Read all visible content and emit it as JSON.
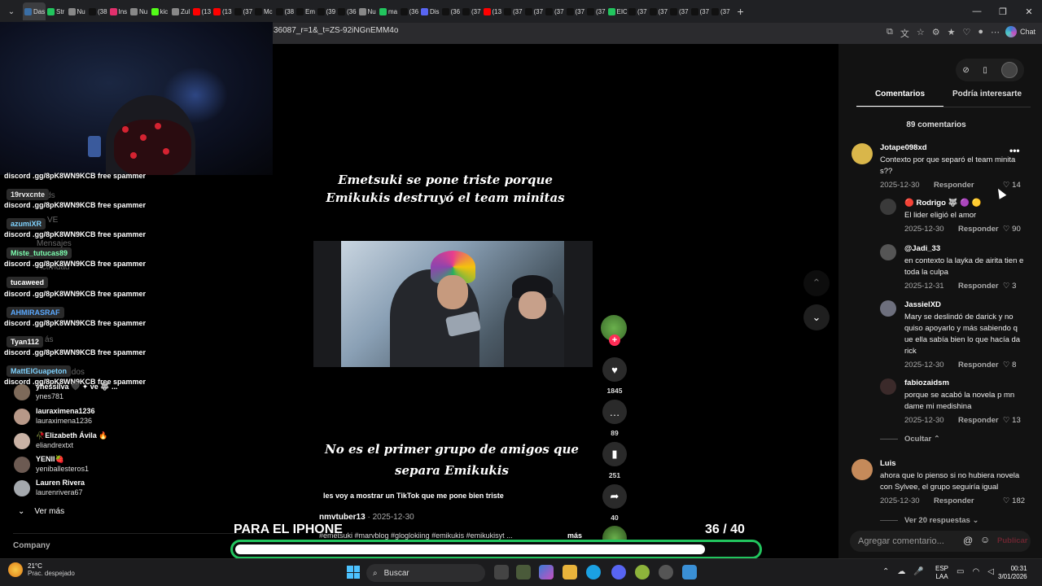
{
  "browser": {
    "tabs": [
      {
        "label": "Das",
        "color": "#3a6ea5",
        "active": true
      },
      {
        "label": "Str",
        "color": "#22c55e"
      },
      {
        "label": "Nu",
        "color": "#888888"
      },
      {
        "label": "(38",
        "color": "#111111"
      },
      {
        "label": "Ins",
        "color": "#e1306c"
      },
      {
        "label": "Nu",
        "color": "#888888"
      },
      {
        "label": "kic",
        "color": "#53fc18"
      },
      {
        "label": "Zul",
        "color": "#888888"
      },
      {
        "label": "(13",
        "color": "#ff0000"
      },
      {
        "label": "(13",
        "color": "#ff0000"
      },
      {
        "label": "(37",
        "color": "#111111"
      },
      {
        "label": "Mc",
        "color": "#111111"
      },
      {
        "label": "(38",
        "color": "#111111"
      },
      {
        "label": "Em",
        "color": "#111111"
      },
      {
        "label": "(39",
        "color": "#111111"
      },
      {
        "label": "(36",
        "color": "#111111"
      },
      {
        "label": "Nu",
        "color": "#888888"
      },
      {
        "label": "ma",
        "color": "#22c55e"
      },
      {
        "label": "(36",
        "color": "#111111"
      },
      {
        "label": "Dis",
        "color": "#5865f2"
      },
      {
        "label": "(36",
        "color": "#111111"
      },
      {
        "label": "(37",
        "color": "#111111"
      },
      {
        "label": "(13",
        "color": "#ff0000"
      },
      {
        "label": "(37",
        "color": "#111111"
      },
      {
        "label": "(37",
        "color": "#111111"
      },
      {
        "label": "(37",
        "color": "#111111"
      },
      {
        "label": "(37",
        "color": "#111111"
      },
      {
        "label": "(37",
        "color": "#111111"
      },
      {
        "label": "EIC",
        "color": "#22c55e"
      },
      {
        "label": "(37",
        "color": "#111111"
      },
      {
        "label": "(37",
        "color": "#111111"
      },
      {
        "label": "(37",
        "color": "#111111"
      },
      {
        "label": "(37",
        "color": "#111111"
      },
      {
        "label": "(37",
        "color": "#111111"
      }
    ],
    "new_tab": "+",
    "url": "36087_r=1&_t=ZS-92iNGnEMM4o",
    "chat_label": "Chat"
  },
  "stream_chat": {
    "spam_text": "discord .gg/8pK8WN9KCB free spammer",
    "users": [
      "19rvxcnte",
      "azumiXR",
      "Miste_tutucas89",
      "tucaweed",
      "AHMIRASRAF",
      "Tyan112",
      "MattElGuapeton"
    ],
    "user_colors": [
      "#e8e8e8",
      "#7fd3ff",
      "#7dffb0",
      "#ffffff",
      "#5aa9ff",
      "#ffffff",
      "#7fd3ff"
    ],
    "ghost_labels": [
      "ends",
      "VE",
      "Mensajes",
      "Actividad",
      "ás",
      "uidos"
    ]
  },
  "following": {
    "items": [
      {
        "name": "yhessilva 🖤 ✦ ve 🐺 ...",
        "handle": "ynes781"
      },
      {
        "name": "lauraximena1236",
        "handle": "lauraximena1236"
      },
      {
        "name": "🥀Elizabeth Ávila 🔥",
        "handle": "eliandrextxt"
      },
      {
        "name": "YENII🍓",
        "handle": "yeniballesteros1"
      },
      {
        "name": "Lauren Rivera",
        "handle": "laurenrivera67"
      }
    ],
    "see_more": "Ver más",
    "company": "Company"
  },
  "video": {
    "caption_top": "Emetsuki se pone triste porque Emikukis destruyó  el team minitas",
    "caption_bottom": "No es el primer grupo de amigos que separa Emikukis",
    "caption_small": "les voy a mostrar un TikTok que me pone bien triste",
    "author": "nmvtuber13",
    "date": " · 2025-12-30",
    "hashtags": "#emetsuki #marvblog #gloglokiing #emikukis #emikukisyt ...",
    "more": "más",
    "likes": "1845",
    "comments": "89",
    "saves": "251",
    "shares": "40"
  },
  "overlay": {
    "label": "PARA EL IPHONE",
    "counter": "36  / 40",
    "progress": 0.9,
    "accent": "#22c55e"
  },
  "comments_panel": {
    "tabs": [
      "Comentarios",
      "Podría interesarte"
    ],
    "count_label": "89 comentarios",
    "reply_label": "Responder",
    "hide_label": "Ocultar",
    "see_replies": "Ver 20 respuestas",
    "placeholder": "Agregar comentario...",
    "publish": "Publicar",
    "comments": [
      {
        "user": "Jotape098xd",
        "text": "Contexto por que separó el team minita s??",
        "date": "2025-12-30",
        "likes": "14"
      },
      {
        "user": "🔴 Rodrigo 🐺 🟣 🟡",
        "text": "El lider eligió el amor",
        "date": "2025-12-30",
        "likes": "90"
      },
      {
        "user": "@Jadi_33",
        "text": "en contexto la layka de airita tien e toda la culpa",
        "date": "2025-12-31",
        "likes": "3"
      },
      {
        "user": "JassielXD",
        "text": "Mary se deslindó de darick y no quiso apoyarlo y más sabiendo q ue ella sabía bien lo que hacía da rick",
        "date": "2025-12-30",
        "likes": "8"
      },
      {
        "user": "fabiozaidsm",
        "text": "porque se acabó la novela p mn dame mi medishina",
        "date": "2025-12-30",
        "likes": "13"
      },
      {
        "user": "Luis",
        "text": "ahora que lo pienso si no hubiera novela con Sylvee, el grupo seguiría igual",
        "date": "2025-12-30",
        "likes": "182"
      }
    ]
  },
  "taskbar": {
    "temp": "21°C",
    "weather": "Prac. despejado",
    "search": "Buscar",
    "lang1": "ESP",
    "lang2": "LAA",
    "time": "00:31",
    "date": "3/01/2026"
  }
}
